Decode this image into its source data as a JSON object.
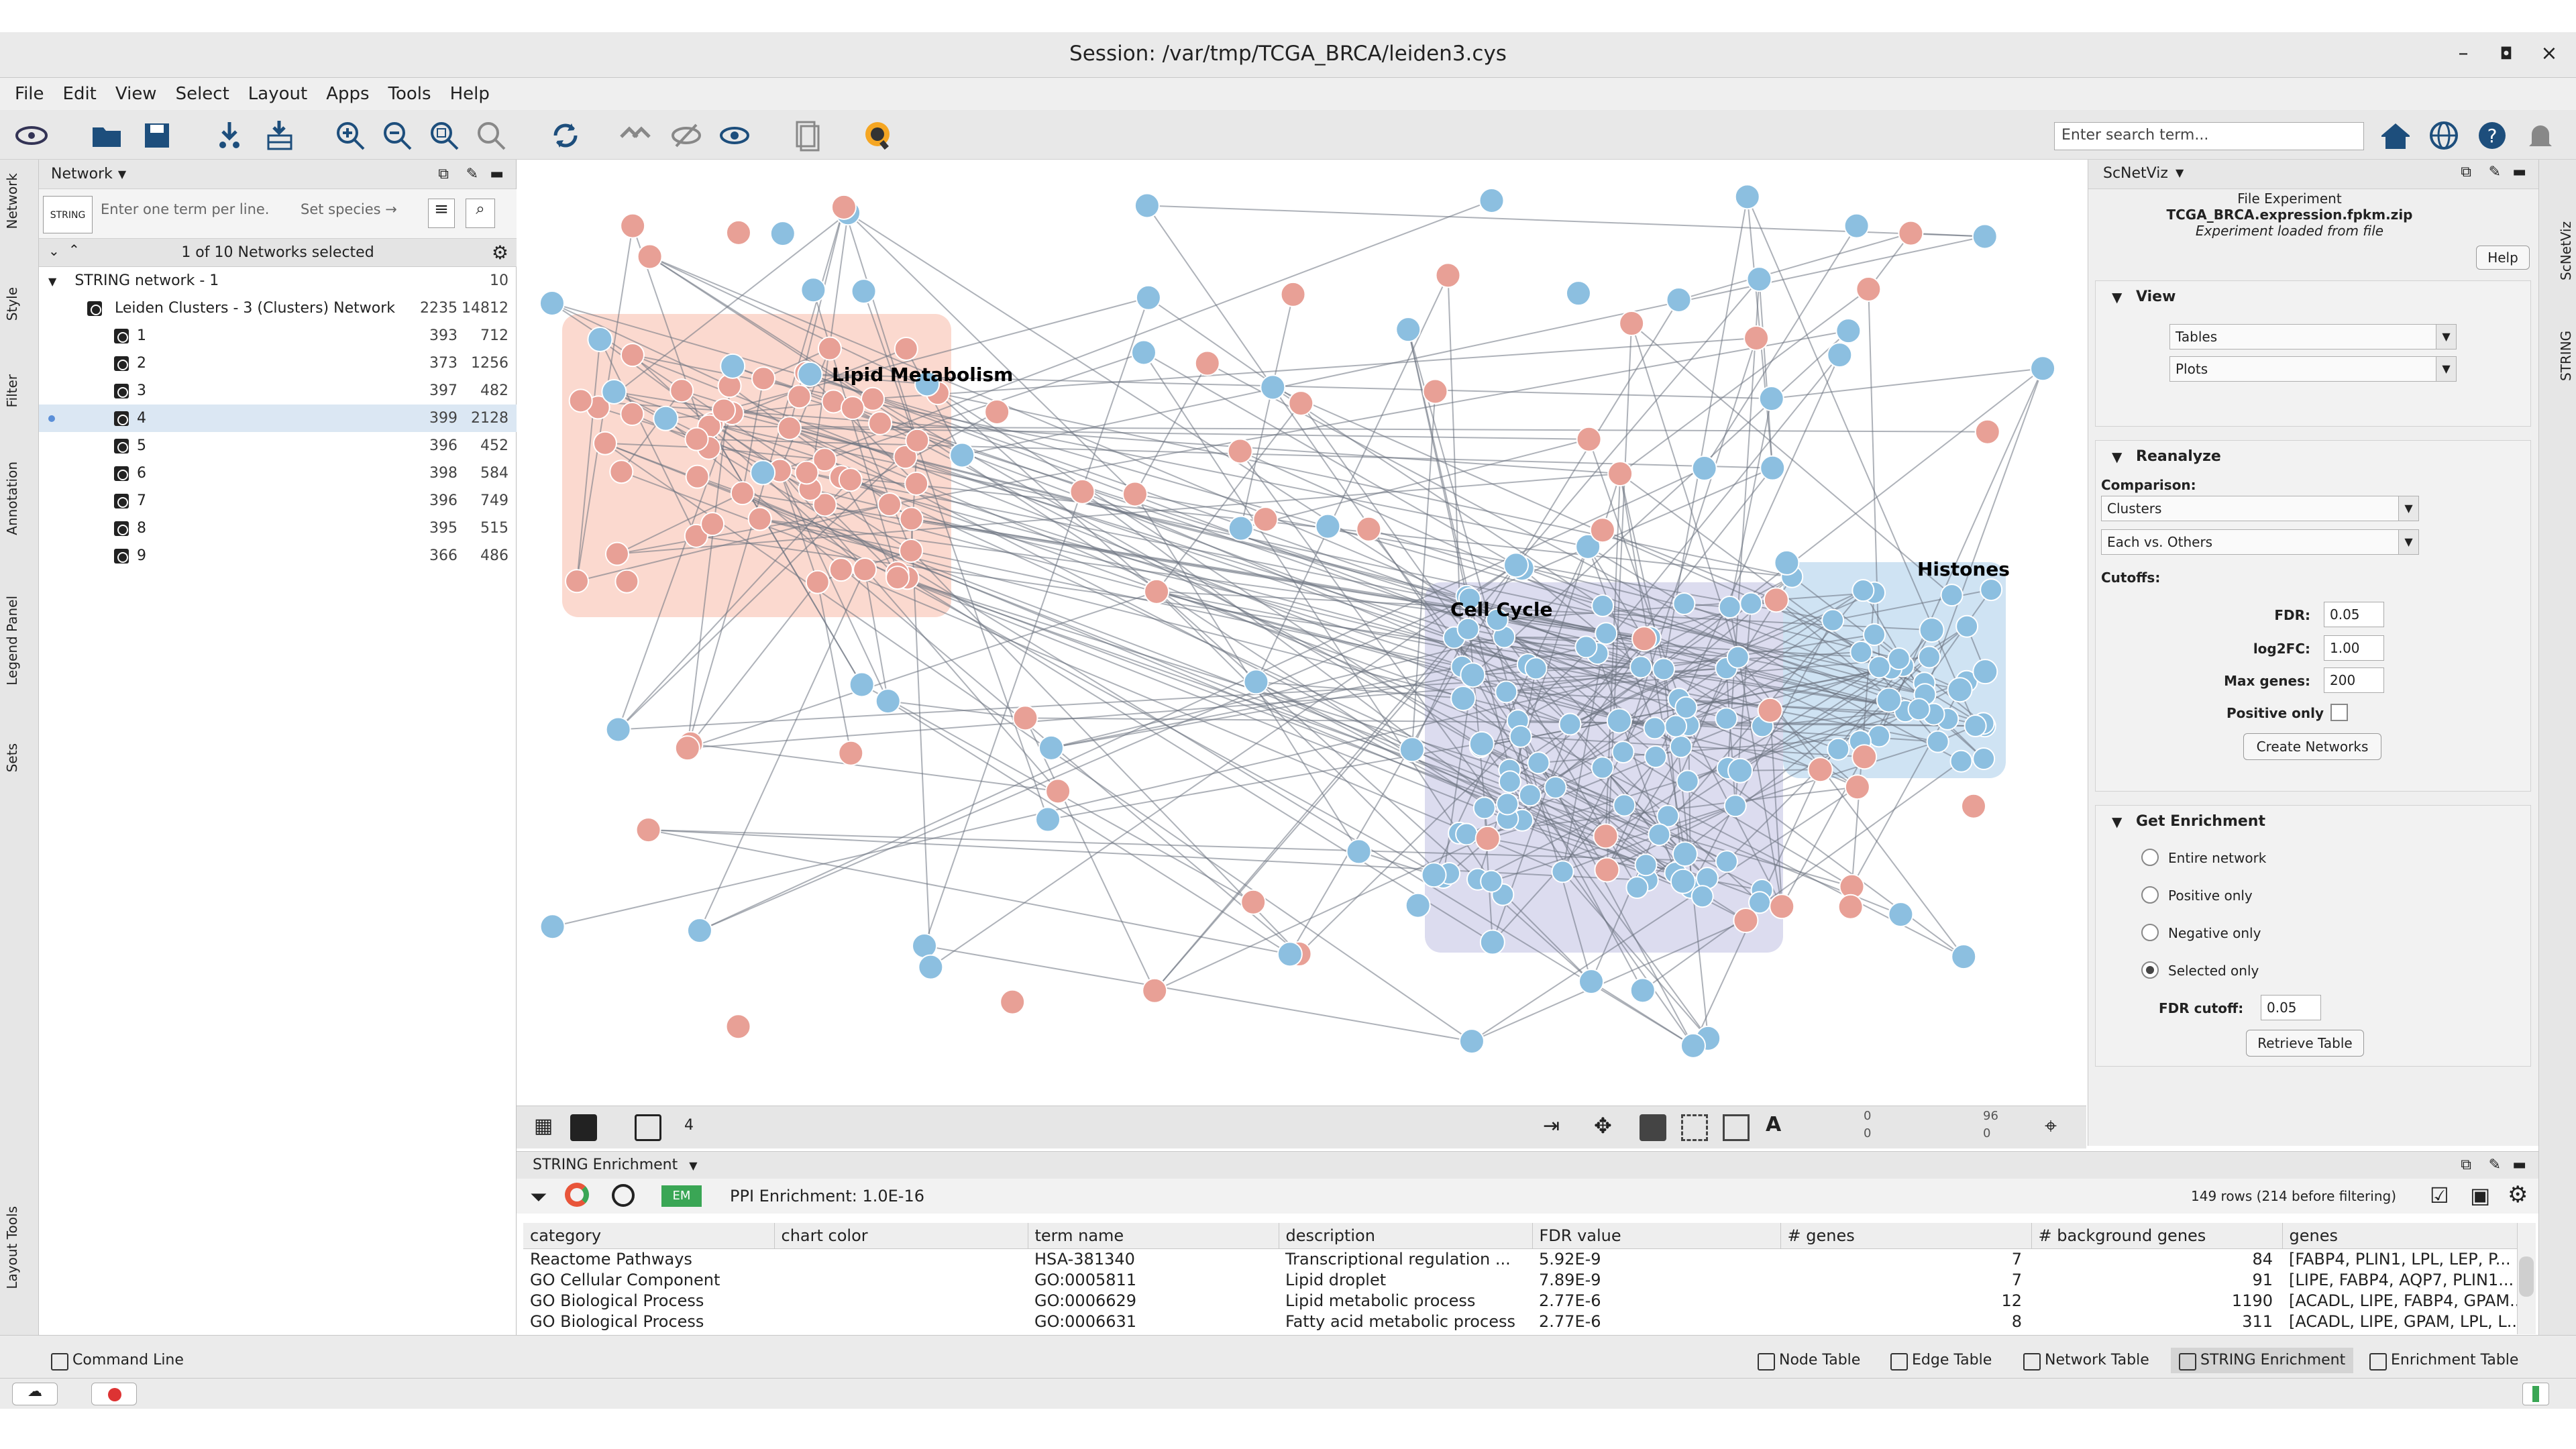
{
  "window": {
    "title": "Session: /var/tmp/TCGA_BRCA/leiden3.cys"
  },
  "menu": [
    "File",
    "Edit",
    "View",
    "Select",
    "Layout",
    "Apps",
    "Tools",
    "Help"
  ],
  "toolbar": {
    "search_placeholder": "Enter search term..."
  },
  "left_tabs": [
    "Network",
    "Style",
    "Filter",
    "Annotation",
    "Legend Panel",
    "Sets",
    "Layout Tools"
  ],
  "network_panel": {
    "title": "Network",
    "search_placeholder": "Enter one term per line.",
    "species_label": "Set species →",
    "selected_text": "1 of 10 Networks selected",
    "root": {
      "label": "STRING network - 1",
      "count": "10"
    },
    "collection": {
      "label": "Leiden Clusters - 3 (Clusters) Network",
      "nodes": "2235",
      "edges": "14812"
    },
    "clusters": [
      {
        "label": "1",
        "nodes": "393",
        "edges": "712"
      },
      {
        "label": "2",
        "nodes": "373",
        "edges": "1256"
      },
      {
        "label": "3",
        "nodes": "397",
        "edges": "482"
      },
      {
        "label": "4",
        "nodes": "399",
        "edges": "2128"
      },
      {
        "label": "5",
        "nodes": "396",
        "edges": "452"
      },
      {
        "label": "6",
        "nodes": "398",
        "edges": "584"
      },
      {
        "label": "7",
        "nodes": "396",
        "edges": "749"
      },
      {
        "label": "8",
        "nodes": "395",
        "edges": "515"
      },
      {
        "label": "9",
        "nodes": "366",
        "edges": "486"
      }
    ]
  },
  "canvas": {
    "groups": [
      "Lipid Metabolism",
      "Cell Cycle",
      "Histones"
    ],
    "bar_count": "4",
    "stats": [
      "0",
      "0",
      "96",
      "0"
    ]
  },
  "scnetviz": {
    "title": "ScNetViz",
    "file_heading": "File Experiment",
    "file_name": "TCGA_BRCA.expression.fpkm.zip",
    "file_note": "Experiment loaded from file",
    "help": "Help",
    "view_section": "View",
    "view_options": [
      "Tables",
      "Plots"
    ],
    "reanalyze_section": "Reanalyze",
    "comparison_label": "Comparison:",
    "comparison_values": [
      "Clusters",
      "Each vs. Others"
    ],
    "cutoffs_label": "Cutoffs:",
    "fdr_label": "FDR:",
    "fdr_value": "0.05",
    "log2fc_label": "log2FC:",
    "log2fc_value": "1.00",
    "maxgenes_label": "Max genes:",
    "maxgenes_value": "200",
    "positive_only_label": "Positive only",
    "create_networks": "Create Networks",
    "enrichment_section": "Get Enrichment",
    "radios": [
      "Entire network",
      "Positive only",
      "Negative only",
      "Selected only"
    ],
    "radio_selected": "Selected only",
    "fdr_cutoff_label": "FDR cutoff:",
    "fdr_cutoff_value": "0.05",
    "retrieve_table": "Retrieve Table"
  },
  "right_tabs": [
    "ScNetViz",
    "STRING"
  ],
  "enrichment": {
    "title": "STRING Enrichment",
    "ppi": "PPI Enrichment: 1.0E-16",
    "rows_info": "149 rows (214 before filtering)",
    "columns": [
      "category",
      "chart color",
      "term name",
      "description",
      "FDR value",
      "# genes",
      "# background genes",
      "genes"
    ],
    "rows": [
      [
        "Reactome Pathways",
        "",
        "HSA-381340",
        "Transcriptional regulation ...",
        "5.92E-9",
        "7",
        "84",
        "[FABP4, PLIN1, LPL, LEP, P..."
      ],
      [
        "GO Cellular Component",
        "",
        "GO:0005811",
        "Lipid droplet",
        "7.89E-9",
        "7",
        "91",
        "[LIPE, FABP4, AQP7, PLIN1..."
      ],
      [
        "GO Biological Process",
        "",
        "GO:0006629",
        "Lipid metabolic process",
        "2.77E-6",
        "12",
        "1190",
        "[ACADL, LIPE, FABP4, GPAM..."
      ],
      [
        "GO Biological Process",
        "",
        "GO:0006631",
        "Fatty acid metabolic process",
        "2.77E-6",
        "8",
        "311",
        "[ACADL, LIPE, GPAM, LPL, L..."
      ]
    ]
  },
  "bottom_tabs": {
    "command_line": "Command Line",
    "tabs": [
      "Node Table",
      "Edge Table",
      "Network Table",
      "STRING Enrichment",
      "Enrichment Table"
    ],
    "active": "STRING Enrichment"
  },
  "colors": {
    "red_node": "#e8a096",
    "blue_node": "#8cbfe0",
    "lipid_group": "#fbd9cf",
    "cycle_group": "#dcdcef",
    "histone_group": "#cfe3f3"
  }
}
